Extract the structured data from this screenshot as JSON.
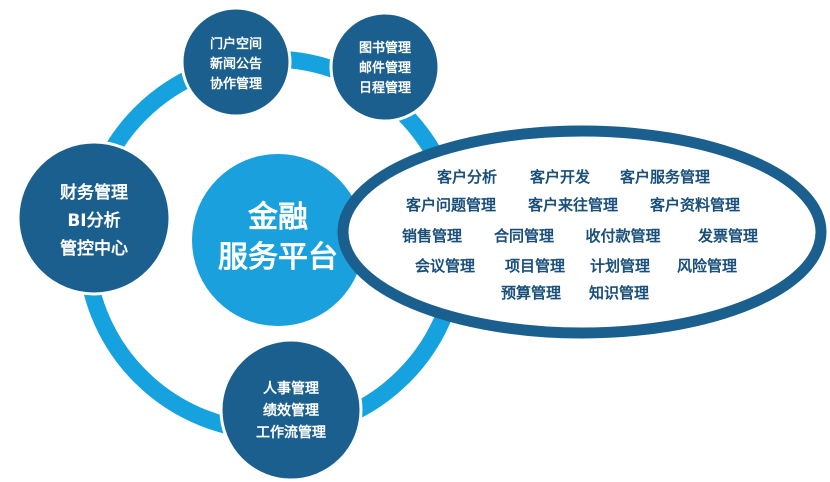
{
  "colors": {
    "ring": "#16a2df",
    "center": "#1aa0dc",
    "satellite": "#1b5f8f",
    "ellipse_border": "#1b5f8f",
    "module_text": "#1a4f7a",
    "text_light": "#ffffff"
  },
  "center": {
    "lines": [
      "金融",
      "服务平台"
    ]
  },
  "satellites": {
    "portal": {
      "lines": [
        "门户空间",
        "新闻公告",
        "协作管理"
      ]
    },
    "library": {
      "lines": [
        "图书管理",
        "邮件管理",
        "日程管理"
      ]
    },
    "finance": {
      "lines": [
        "财务管理",
        "BI分析",
        "管控中心"
      ]
    },
    "hr": {
      "lines": [
        "人事管理",
        "绩效管理",
        "工作流管理"
      ]
    }
  },
  "modules": {
    "rows": [
      [
        "客户分析",
        "客户开发",
        "客户服务管理"
      ],
      [
        "客户问题管理",
        "客户来往管理",
        "客户资料管理"
      ],
      [
        "销售管理",
        "合同管理",
        "收付款管理",
        "发票管理"
      ],
      [
        "会议管理",
        "项目管理",
        "计划管理",
        "风险管理"
      ],
      [
        "预算管理",
        "知识管理"
      ]
    ]
  }
}
